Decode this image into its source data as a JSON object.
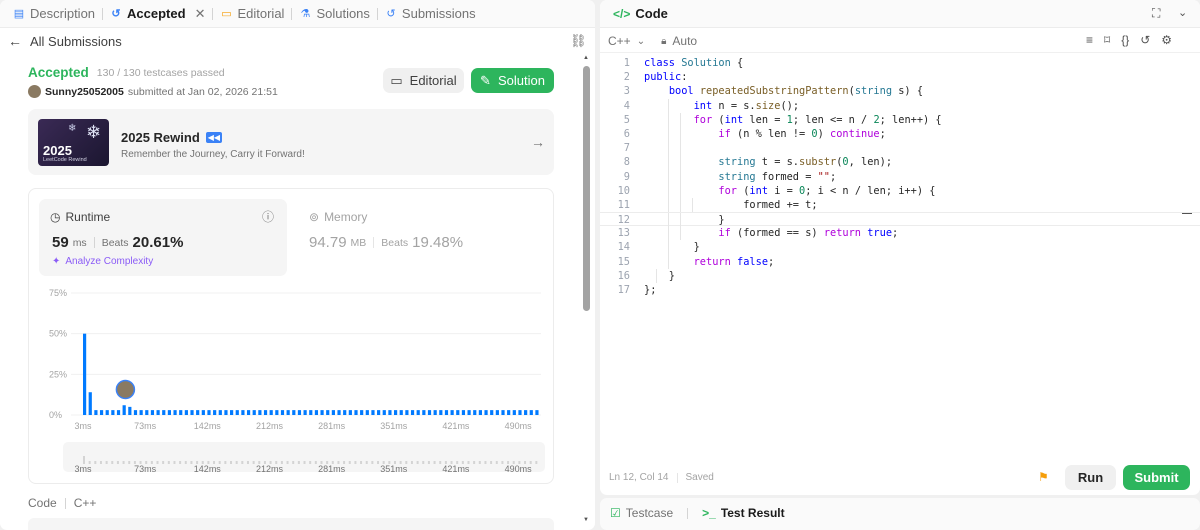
{
  "left_tabs": [
    {
      "label": "Description",
      "icon": "description-icon"
    },
    {
      "label": "Accepted",
      "icon": "history-icon",
      "active": true
    },
    {
      "label": "Editorial",
      "icon": "book-icon"
    },
    {
      "label": "Solutions",
      "icon": "flask-icon"
    },
    {
      "label": "Submissions",
      "icon": "history-icon"
    }
  ],
  "nav": {
    "back_label": "All Submissions"
  },
  "result": {
    "status": "Accepted",
    "testcases": "130 / 130 testcases passed",
    "user": "Sunny25052005",
    "submitted": "submitted at Jan 02, 2026 21:51",
    "editorial_btn": "Editorial",
    "solution_btn": "Solution"
  },
  "banner": {
    "title": "2025 Rewind",
    "subtitle": "Remember the Journey, Carry it Forward!",
    "thumb_year": "2025",
    "thumb_caption": "LeetCode Rewind"
  },
  "runtime": {
    "label": "Runtime",
    "value": "59",
    "unit": "ms",
    "beats_label": "Beats",
    "beats": "20.61%",
    "analyze": "Analyze Complexity"
  },
  "memory": {
    "label": "Memory",
    "value": "94.79",
    "unit": "MB",
    "beats_label": "Beats",
    "beats": "19.48%"
  },
  "chart_data": {
    "type": "bar",
    "y_ticks": [
      "75%",
      "50%",
      "25%",
      "0%"
    ],
    "x_ticks": [
      "3ms",
      "73ms",
      "142ms",
      "212ms",
      "281ms",
      "351ms",
      "421ms",
      "490ms"
    ],
    "ylim": [
      0,
      75
    ],
    "values": [
      50,
      14,
      3,
      3,
      3,
      3,
      3,
      6,
      5,
      3,
      3,
      3,
      3,
      3,
      3,
      3,
      3,
      3,
      3,
      3,
      3,
      3,
      3,
      3,
      3,
      3,
      3,
      3,
      3,
      3,
      3,
      3,
      3,
      3,
      3,
      3,
      3,
      3,
      3,
      3,
      3,
      3,
      3,
      3,
      3,
      3,
      3,
      3,
      3,
      3,
      3,
      3,
      3,
      3,
      3,
      3,
      3,
      3,
      3,
      3,
      3,
      3,
      3,
      3,
      3,
      3,
      3,
      3,
      3,
      3,
      3,
      3,
      3,
      3,
      3,
      3,
      3,
      3,
      3,
      3,
      3
    ],
    "user_marker_ms": "59ms",
    "colors": {
      "bar": "#007aff"
    }
  },
  "footer": {
    "lang_label": "Code",
    "lang": "C++"
  },
  "editor": {
    "title": "Code",
    "language": "C++",
    "mode": "Auto",
    "status_pos": "Ln 12, Col 14",
    "status_saved": "Saved",
    "run": "Run",
    "submit": "Submit"
  },
  "code_lines": [
    "<span class='kw'>class</span> <span class='ty'>Solution</span> {",
    "<span class='kw'>public</span>:",
    "    <span class='kw'>bool</span> <span class='fn'>repeatedSubstringPattern</span>(<span class='ty'>string</span> s) {",
    "        <span class='kw'>int</span> n = s.<span class='fn'>size</span>();",
    "        <span class='ctl'>for</span> (<span class='kw'>int</span> len = <span class='nm'>1</span>; len &lt;= n / <span class='nm'>2</span>; len++) {",
    "            <span class='ctl'>if</span> (n % len != <span class='nm'>0</span>) <span class='ctl'>continue</span>;",
    "",
    "            <span class='ty'>string</span> t = s.<span class='fn'>substr</span>(<span class='nm'>0</span>, len);",
    "            <span class='ty'>string</span> formed = <span class='st'>\"\"</span>;",
    "            <span class='ctl'>for</span> (<span class='kw'>int</span> i = <span class='nm'>0</span>; i &lt; n / len; i++) {",
    "                formed += t;",
    "            }",
    "            <span class='ctl'>if</span> (formed == s) <span class='ctl'>return</span> <span class='kw'>true</span>;",
    "        }",
    "        <span class='ctl'>return</span> <span class='kw'>false</span>;",
    "    }",
    "};"
  ],
  "bottom_tabs": [
    {
      "label": "Testcase"
    },
    {
      "label": "Test Result",
      "active": true
    }
  ]
}
